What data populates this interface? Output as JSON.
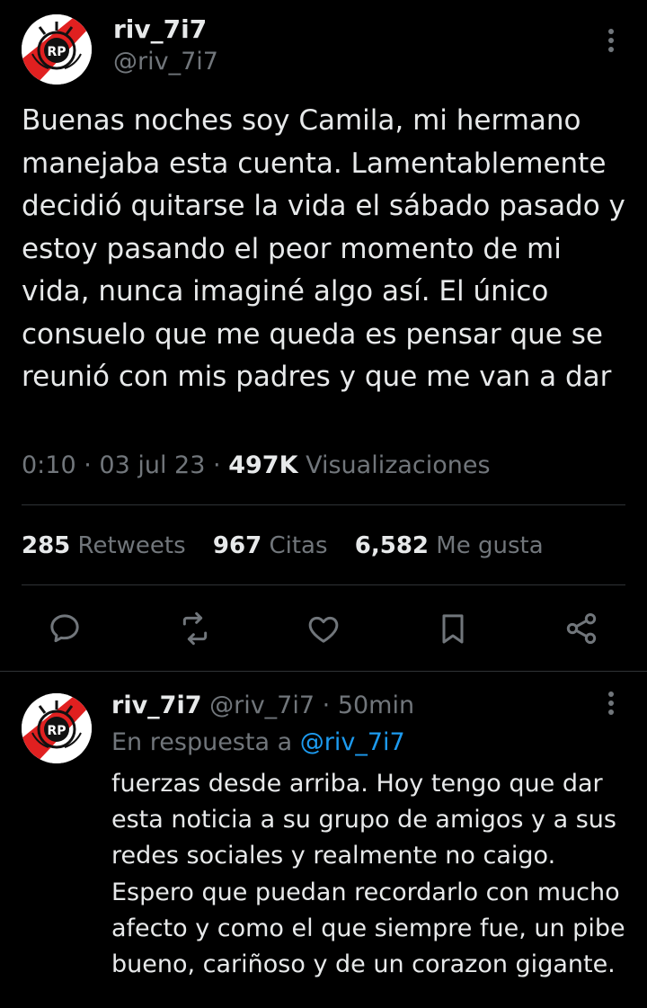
{
  "main_tweet": {
    "author": {
      "name": "riv_7i7",
      "handle": "@riv_7i7"
    },
    "text": "Buenas noches soy Camila, mi hermano manejaba esta cuenta. Lamentablemente decidió quitarse la vida el sábado pasado y estoy pasando el peor momento de mi vida, nunca imaginé algo así. El único consuelo que me queda es pensar que se reunió con mis padres y que me van a dar",
    "time": "0:10",
    "date": "03 jul 23",
    "separator": "·",
    "views_count": "497K",
    "views_label": "Visualizaciones",
    "stats": {
      "retweets_count": "285",
      "retweets_label": "Retweets",
      "quotes_count": "967",
      "quotes_label": "Citas",
      "likes_count": "6,582",
      "likes_label": "Me gusta"
    }
  },
  "actions": [
    "reply-icon",
    "retweet-icon",
    "like-icon",
    "bookmark-icon",
    "share-icon"
  ],
  "reply": {
    "author": {
      "name": "riv_7i7",
      "handle": "@riv_7i7"
    },
    "separator": "·",
    "time_ago": "50min",
    "in_reply_to_label": "En respuesta a",
    "in_reply_to_handle": "@riv_7i7",
    "text": "fuerzas desde arriba. Hoy tengo que dar esta noticia a su grupo de amigos y a sus redes sociales y realmente no caigo. Espero que puedan recordarlo con mucho afecto y como el que siempre fue, un pibe bueno, cariñoso y de un corazon gigante."
  },
  "colors": {
    "background": "#000000",
    "text_primary": "#e7e9ea",
    "text_secondary": "#71767b",
    "link": "#1d9bf0",
    "divider": "#2f3336",
    "avatar_band": "#e02020"
  }
}
